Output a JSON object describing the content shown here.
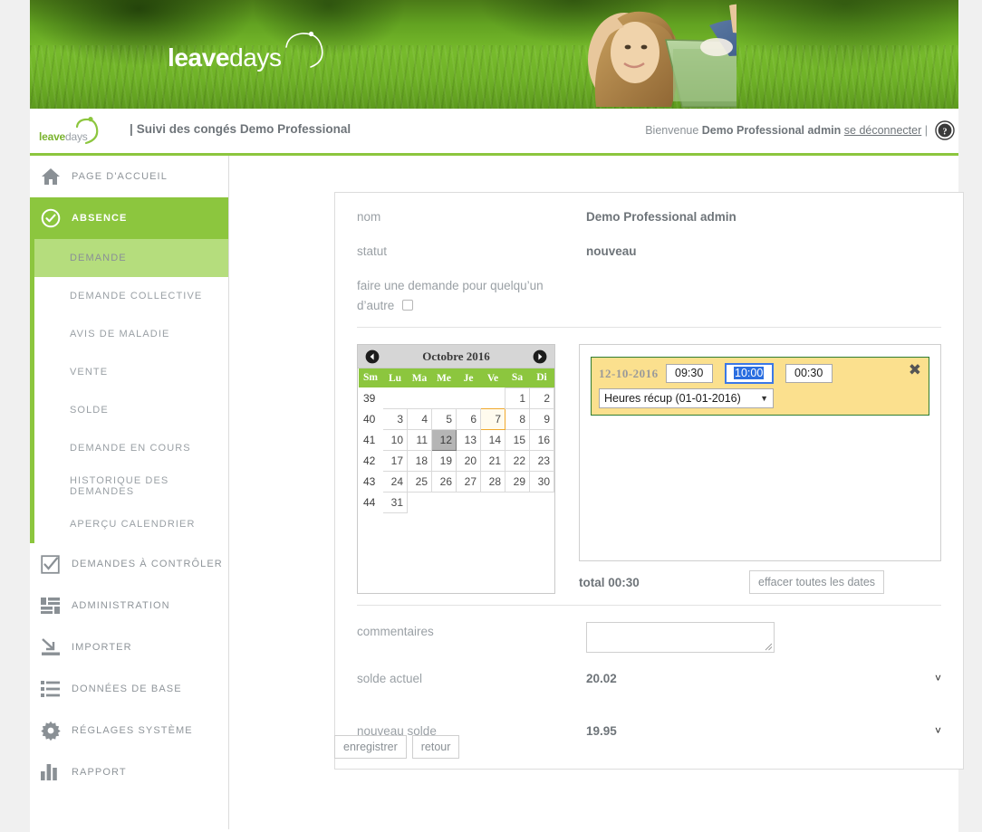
{
  "banner": {
    "logo_bold": "leave",
    "logo_light": "days"
  },
  "topbar": {
    "logo_bold": "leave",
    "logo_light": "days",
    "pipe": "|",
    "app_title": "Suivi des congés Demo Professional",
    "welcome_prefix": "Bienvenue",
    "user_name": "Demo Professional admin",
    "logout_label": "se déconnecter",
    "trailing_pipe": "|",
    "help_icon": "help-circle-icon"
  },
  "sidebar": {
    "items": [
      {
        "label": "PAGE D'ACCUEIL",
        "icon": "home-icon",
        "name": "home"
      },
      {
        "label": "ABSENCE",
        "icon": "check-circle-icon",
        "name": "absence",
        "active": true
      },
      {
        "label": "DEMANDES À CONTRÔLER",
        "icon": "checkbox-task-icon",
        "name": "demandes-a-controler"
      },
      {
        "label": "ADMINISTRATION",
        "icon": "admin-bars-icon",
        "name": "administration"
      },
      {
        "label": "IMPORTER",
        "icon": "import-arrow-icon",
        "name": "importer"
      },
      {
        "label": "DONNÉES DE BASE",
        "icon": "list-icon",
        "name": "donnees-de-base"
      },
      {
        "label": "RÉGLAGES SYSTÈME",
        "icon": "gear-icon",
        "name": "reglages-systeme"
      },
      {
        "label": "RAPPORT",
        "icon": "bar-chart-icon",
        "name": "rapport"
      }
    ],
    "absence_subitems": [
      {
        "label": "DEMANDE",
        "name": "demande",
        "active": true
      },
      {
        "label": "DEMANDE COLLECTIVE",
        "name": "demande-collective"
      },
      {
        "label": "AVIS DE MALADIE",
        "name": "avis-de-maladie"
      },
      {
        "label": "VENTE",
        "name": "vente"
      },
      {
        "label": "SOLDE",
        "name": "solde"
      },
      {
        "label": "DEMANDE EN COURS",
        "name": "demande-en-cours"
      },
      {
        "label": "HISTORIQUE DES DEMANDES",
        "name": "historique-des-demandes"
      },
      {
        "label": "APERÇU CALENDRIER",
        "name": "apercu-calendrier"
      }
    ]
  },
  "form": {
    "nom_label": "nom",
    "nom_value": "Demo Professional admin",
    "statut_label": "statut",
    "statut_value": "nouveau",
    "proxy_label_line1": "faire une demande pour quelqu’un",
    "proxy_label_line2": "d’autre",
    "proxy_checked": false,
    "commentaires_label": "commentaires",
    "commentaires_value": "",
    "solde_actuel_label": "solde actuel",
    "solde_actuel_value": "20.02",
    "nouveau_solde_label": "nouveau solde",
    "nouveau_solde_value": "19.95",
    "save_label": "enregistrer",
    "back_label": "retour"
  },
  "calendar": {
    "month_title": "Octobre 2016",
    "prev_icon": "chevron-left-circle-icon",
    "next_icon": "chevron-right-circle-icon",
    "headers": [
      "Sm",
      "Lu",
      "Ma",
      "Me",
      "Je",
      "Ve",
      "Sa",
      "Di"
    ],
    "weeks": [
      {
        "wk": "39",
        "days": [
          "",
          "",
          "",
          "",
          "",
          "1",
          "2"
        ]
      },
      {
        "wk": "40",
        "days": [
          "3",
          "4",
          "5",
          "6",
          "7",
          "8",
          "9"
        ]
      },
      {
        "wk": "41",
        "days": [
          "10",
          "11",
          "12",
          "13",
          "14",
          "15",
          "16"
        ]
      },
      {
        "wk": "42",
        "days": [
          "17",
          "18",
          "19",
          "20",
          "21",
          "22",
          "23"
        ]
      },
      {
        "wk": "43",
        "days": [
          "24",
          "25",
          "26",
          "27",
          "28",
          "29",
          "30"
        ]
      },
      {
        "wk": "44",
        "days": [
          "31",
          "",
          "",
          "",
          "",
          "",
          ""
        ]
      }
    ],
    "today": "7",
    "selected": "12"
  },
  "entries": {
    "list": [
      {
        "date": "12-10-2016",
        "start_time": "09:30",
        "end_time": "10:00",
        "duration": "00:30",
        "type": "Heures récup (01-01-2016)",
        "remove_icon": "close-x-icon",
        "end_time_focused": true
      }
    ],
    "total_label": "total 00:30",
    "clear_label": "effacer toutes les dates"
  },
  "colors": {
    "brand_green": "#8cc63e",
    "subitem_green": "#b5dd7d",
    "entry_yellow": "#fbe08e",
    "entry_border": "#2e7d32",
    "focus_blue": "#2a6ee0",
    "today_orange": "#f0a92e"
  }
}
